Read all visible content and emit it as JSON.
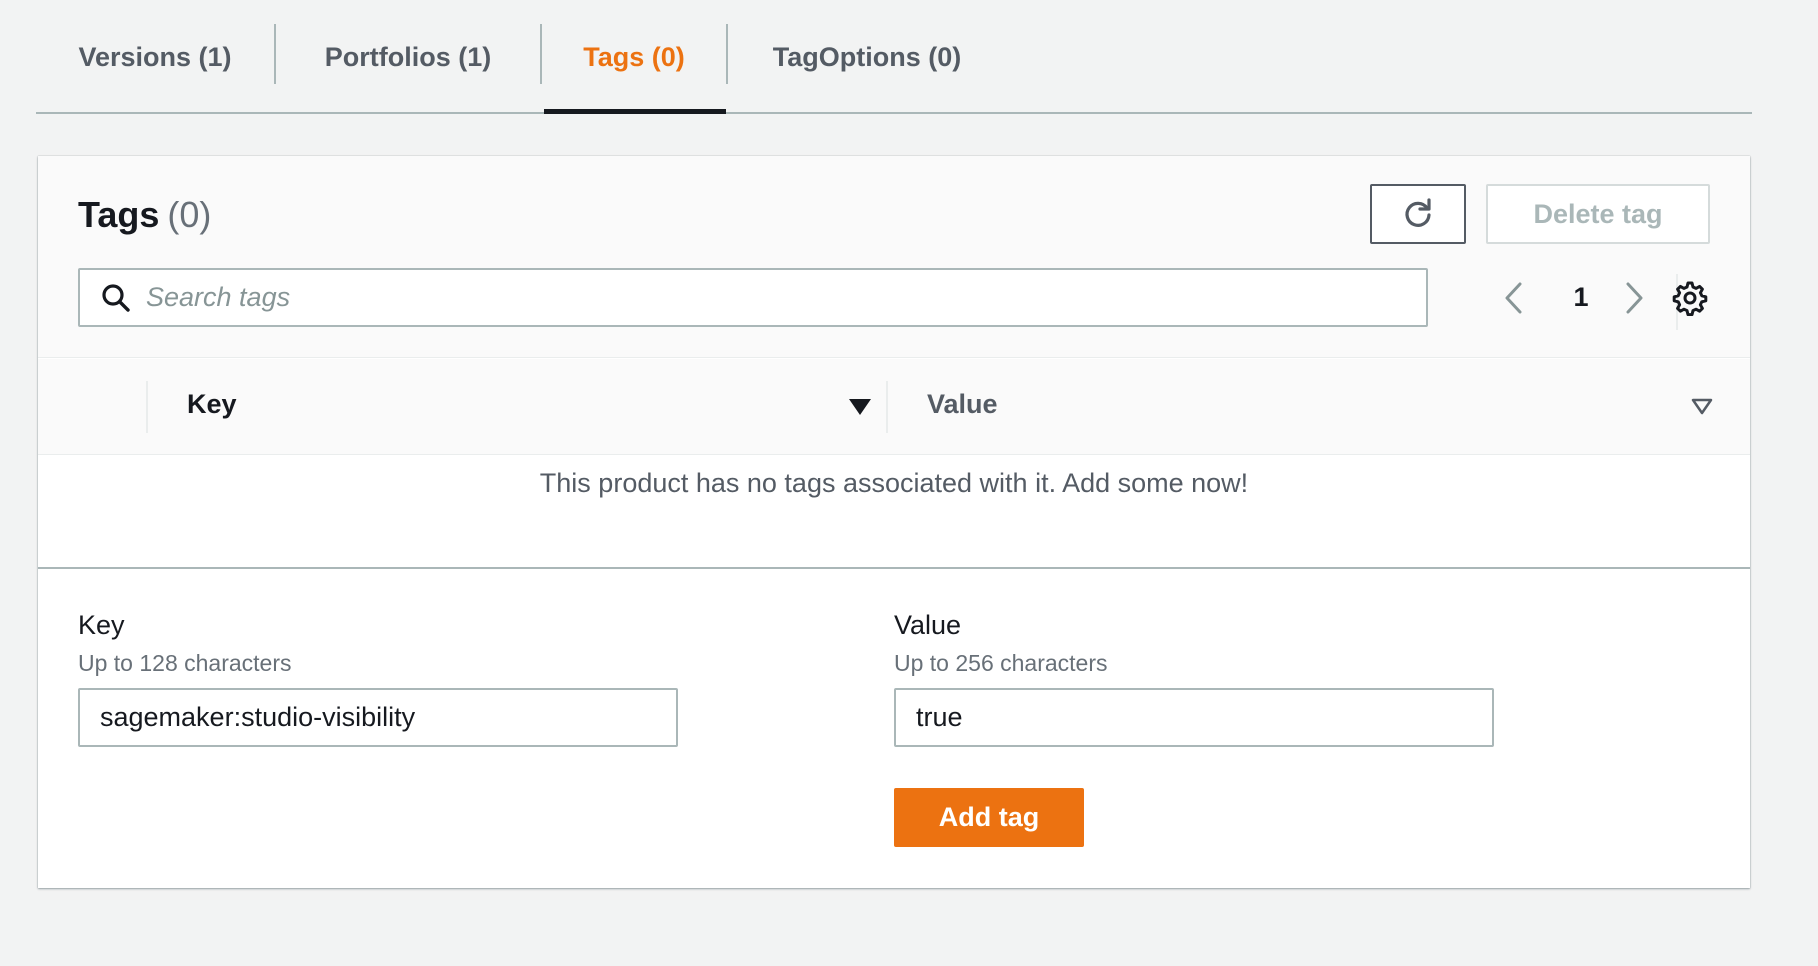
{
  "tabs": [
    {
      "label": "Versions (1)",
      "active": false
    },
    {
      "label": "Portfolios (1)",
      "active": false
    },
    {
      "label": "Tags (0)",
      "active": true
    },
    {
      "label": "TagOptions (0)",
      "active": false
    }
  ],
  "header": {
    "title": "Tags",
    "count": "(0)",
    "refresh_icon": "refresh-icon",
    "delete_label": "Delete tag"
  },
  "search": {
    "placeholder": "Search tags",
    "value": ""
  },
  "pagination": {
    "current_page": "1"
  },
  "table": {
    "columns": [
      "Key",
      "Value"
    ],
    "empty_message": "This product has no tags associated with it. Add some now!"
  },
  "form": {
    "key": {
      "label": "Key",
      "description": "Up to 128 characters",
      "value": "sagemaker:studio-visibility"
    },
    "value": {
      "label": "Value",
      "description": "Up to 256 characters",
      "value": "true"
    },
    "add_label": "Add tag"
  },
  "colors": {
    "accent": "#ec7211",
    "text": "#16191f",
    "muted": "#687078",
    "border": "#aab7b8",
    "background": "#f2f3f3"
  }
}
